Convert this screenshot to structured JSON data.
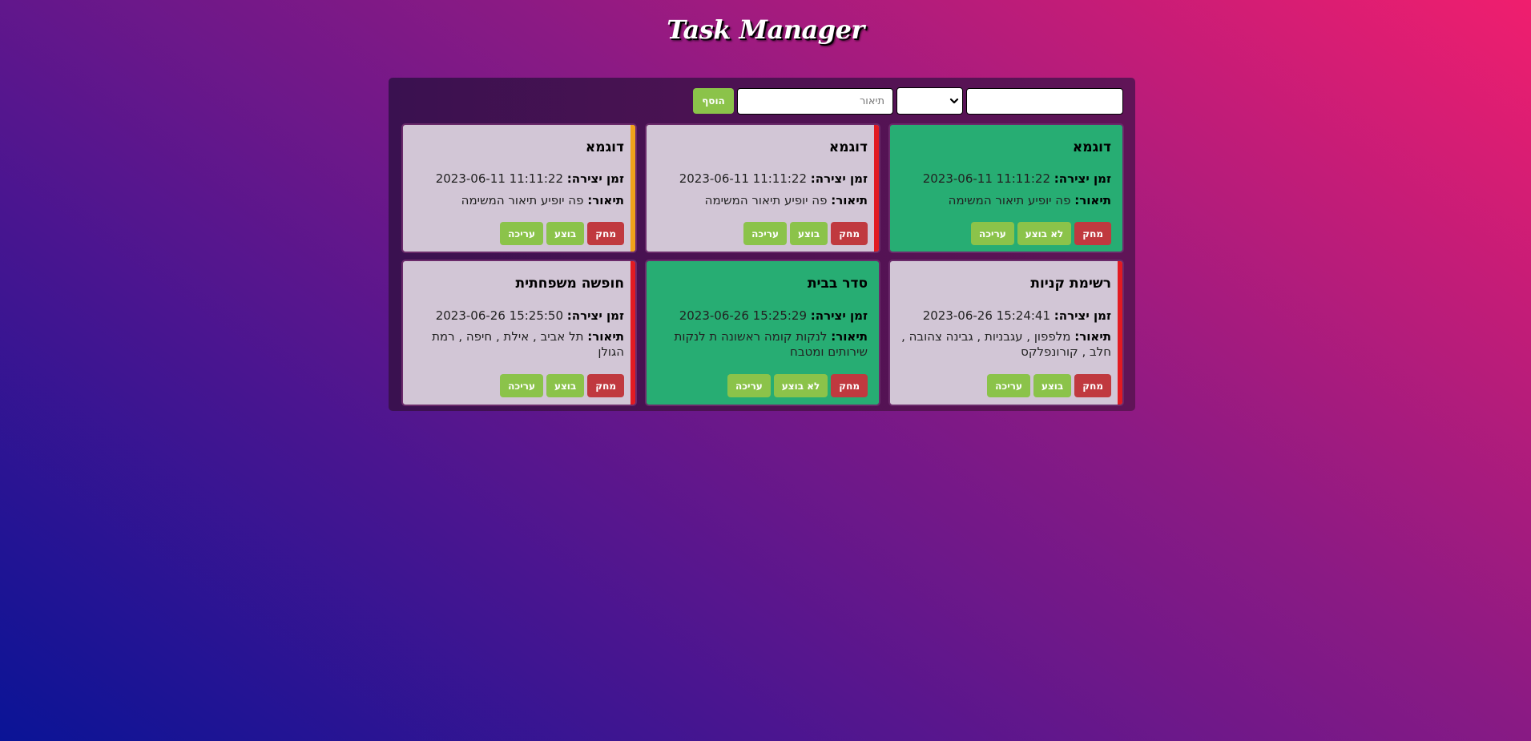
{
  "app": {
    "title": "Task Manager"
  },
  "add_form": {
    "title_value": "",
    "priority_value": "",
    "description_placeholder": "תיאור",
    "add_label": "הוסף"
  },
  "labels": {
    "created": "זמן יצירה:",
    "description": "תיאור:",
    "delete": "מחק",
    "edit": "עריכה",
    "mark_done": "בוצע",
    "mark_undone": "לא בוצע"
  },
  "colors": {
    "card_pending": "#d2c6d6",
    "card_done": "#27ad73",
    "priority_high": "#e11b22",
    "priority_medium": "#f0a21a",
    "delete_button": "#c0393f",
    "action_button": "#8bc34a"
  },
  "tasks": [
    {
      "title": "דוגמא",
      "created": "2023-06-11 11:11:22",
      "description": "פה יופיע תיאור המשימה",
      "done": true,
      "toggle_label": "לא בוצע",
      "priority_color": ""
    },
    {
      "title": "דוגמא",
      "created": "2023-06-11 11:11:22",
      "description": "פה יופיע תיאור המשימה",
      "done": false,
      "toggle_label": "בוצע",
      "priority_color": "#e11b22"
    },
    {
      "title": "דוגמא",
      "created": "2023-06-11 11:11:22",
      "description": "פה יופיע תיאור המשימה",
      "done": false,
      "toggle_label": "בוצע",
      "priority_color": "#f0a21a"
    },
    {
      "title": "רשימת קניות",
      "created": "2023-06-26 15:24:41",
      "description": "מלפפון , עגבניות , גבינה צהובה , חלב , קורונפלקס",
      "done": false,
      "toggle_label": "בוצע",
      "priority_color": "#e11b22"
    },
    {
      "title": "סדר בבית",
      "created": "2023-06-26 15:25:29",
      "description": "לנקות קומה ראשונה ת לנקות שירותים ומטבח",
      "done": true,
      "toggle_label": "לא בוצע",
      "priority_color": ""
    },
    {
      "title": "חופשה משפחתית",
      "created": "2023-06-26 15:25:50",
      "description": "תל אביב , אילת , חיפה , רמת הגולן",
      "done": false,
      "toggle_label": "בוצע",
      "priority_color": "#e11b22"
    }
  ]
}
